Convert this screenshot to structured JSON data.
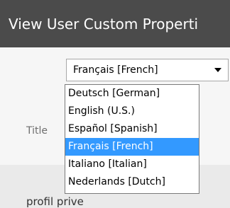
{
  "header": {
    "title": "View User Custom Properti"
  },
  "form": {
    "field_label": "Title",
    "profile_text": "profil prive"
  },
  "language_select": {
    "selected_value": "Français [French]",
    "options": [
      "Deutsch [German]",
      "English (U.S.)",
      "Español [Spanish]",
      "Français [French]",
      "Italiano [Italian]",
      "Nederlands [Dutch]"
    ],
    "selected_index": 3
  },
  "colors": {
    "header_bg": "#4b4b4b",
    "selection_bg": "#3399ff"
  },
  "icons": {
    "dropdown_arrow": "chevron-down-icon"
  }
}
